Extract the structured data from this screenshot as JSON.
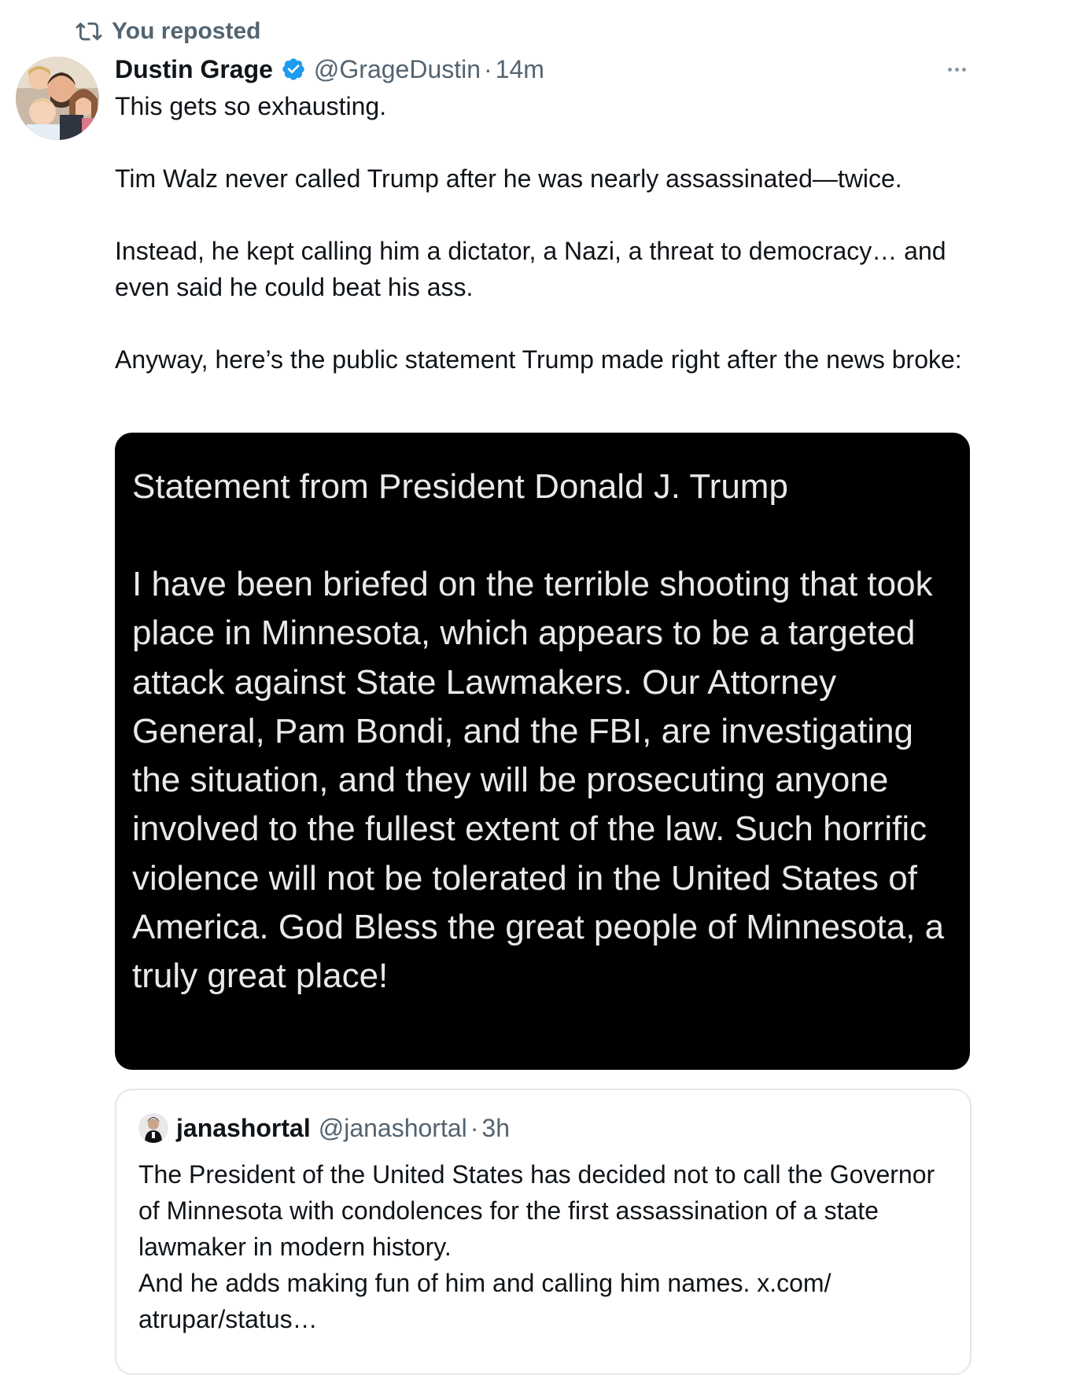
{
  "repost_label": "You reposted",
  "tweet": {
    "author_name": "Dustin Grage",
    "handle": "@GrageDustin",
    "separator": "·",
    "time": "14m",
    "paragraphs": [
      "This gets so exhausting.",
      "Tim Walz never called Trump after he was nearly assassinated—twice.",
      "Instead, he kept calling him a dictator, a Nazi, a threat to democracy… and even said he could beat his ass.",
      "Anyway, here’s the public statement Trump made right after the news broke:"
    ]
  },
  "media": {
    "title": "Statement from President Donald J. Trump",
    "body": "I have been briefed on the terrible shooting that took place in Minnesota, which appears to be a targeted attack against State Lawmakers. Our Attorney General, Pam Bondi, and the FBI, are investigating the situation, and they will be prosecuting anyone involved to the fullest extent of the law. Such horrific violence will not be tolerated in the United States of America. God Bless the great people of Minnesota, a truly great place!"
  },
  "quote": {
    "author_name": "janashortal",
    "handle": "@janashortal",
    "separator": "·",
    "time": "3h",
    "lines": [
      "The President of the United States has decided not to call the Governor of Minnesota with condolences for the first assassination of a state lawmaker in modern history.",
      "And he adds making fun of him and calling him names. x.com/ atrupar/status…"
    ]
  },
  "icons": {
    "repost": "repost-icon",
    "verified": "verified-badge-icon",
    "more": "more-options-icon"
  },
  "colors": {
    "text_primary": "#0f1419",
    "text_secondary": "#536471",
    "verified_blue": "#1d9bf0",
    "media_background": "#000000",
    "media_text": "#e7e9ea",
    "card_border": "#e1e8ed"
  }
}
